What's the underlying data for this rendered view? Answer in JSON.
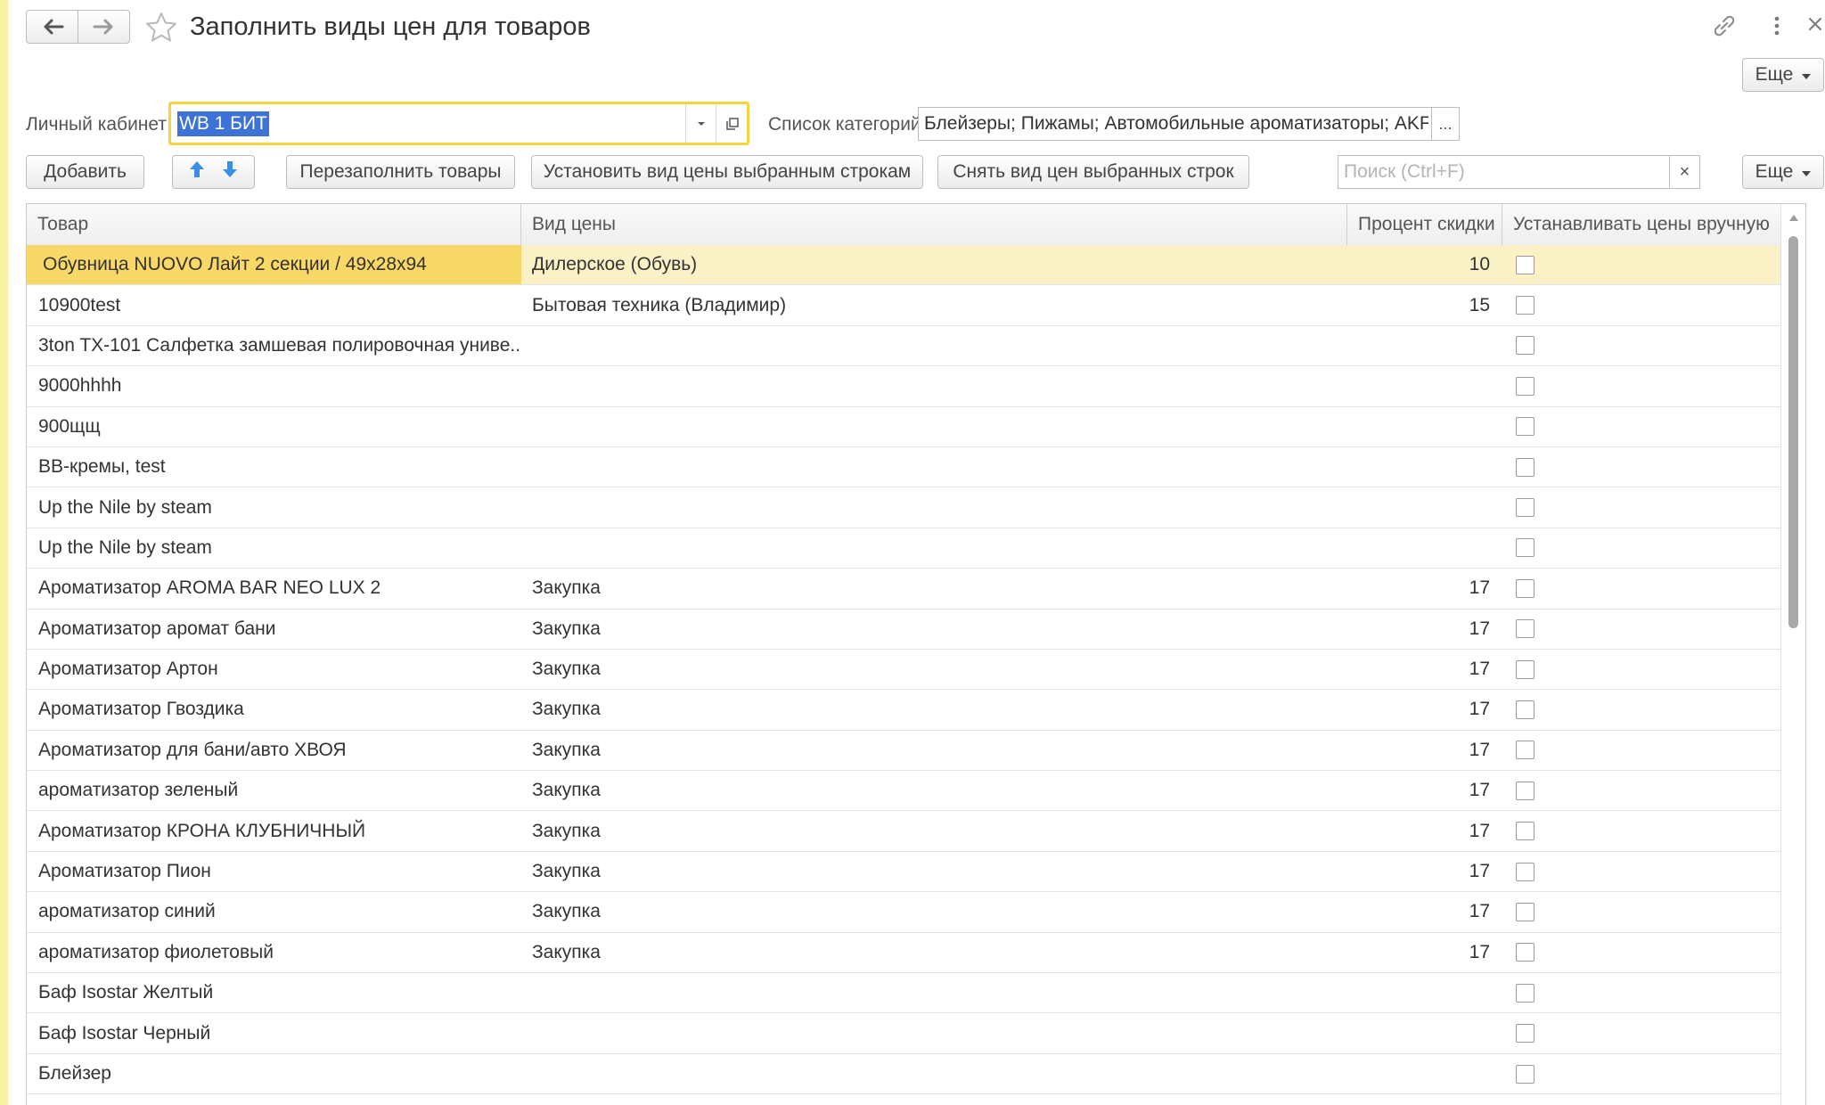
{
  "window": {
    "title": "Заполнить виды цен для товаров",
    "more_label": "Еще"
  },
  "form": {
    "cabinet_label": "Личный кабинет:",
    "cabinet_value": "WB 1 БИТ",
    "categories_label": "Список категорий:",
    "categories_value": "Блейзеры; Пижамы; Автомобильные ароматизаторы; AKF систе",
    "categories_more": "..."
  },
  "toolbar": {
    "add_label": "Добавить",
    "refill_label": "Перезаполнить товары",
    "set_price_label": "Установить вид цены выбранным строкам",
    "remove_price_label": "Снять вид цен выбранных строк",
    "search_placeholder": "Поиск (Ctrl+F)",
    "search_clear": "×",
    "more_label": "Еще"
  },
  "table": {
    "columns": [
      "Товар",
      "Вид цены",
      "Процент скидки",
      "Устанавливать цены вручную"
    ],
    "rows": [
      {
        "item": "Обувница NUOVO Лайт 2 секции / 49x28x94",
        "price_type": "Дилерское (Обувь)",
        "discount": "10",
        "manual": false,
        "selected": true
      },
      {
        "item": "10900test",
        "price_type": "Бытовая техника (Владимир)",
        "discount": "15",
        "manual": false
      },
      {
        "item": "3ton TX-101 Салфетка замшевая полировочная униве...",
        "price_type": "",
        "discount": "",
        "manual": false
      },
      {
        "item": "9000hhhh",
        "price_type": "",
        "discount": "",
        "manual": false
      },
      {
        "item": "900щщ",
        "price_type": "",
        "discount": "",
        "manual": false
      },
      {
        "item": "BB-кремы, test",
        "price_type": "",
        "discount": "",
        "manual": false
      },
      {
        "item": "Up the Nile by steam",
        "price_type": "",
        "discount": "",
        "manual": false
      },
      {
        "item": "Up the Nile by steam",
        "price_type": "",
        "discount": "",
        "manual": false
      },
      {
        "item": "Ароматизатор AROMA BAR NEO LUX 2",
        "price_type": "Закупка",
        "discount": "17",
        "manual": false
      },
      {
        "item": "Ароматизатор аромат бани",
        "price_type": "Закупка",
        "discount": "17",
        "manual": false
      },
      {
        "item": "Ароматизатор Артон",
        "price_type": "Закупка",
        "discount": "17",
        "manual": false
      },
      {
        "item": "Ароматизатор Гвоздика",
        "price_type": "Закупка",
        "discount": "17",
        "manual": false
      },
      {
        "item": "Ароматизатор для бани/авто ХВОЯ",
        "price_type": "Закупка",
        "discount": "17",
        "manual": false
      },
      {
        "item": "ароматизатор зеленый",
        "price_type": "Закупка",
        "discount": "17",
        "manual": false
      },
      {
        "item": "Ароматизатор КРОНА КЛУБНИЧНЫЙ",
        "price_type": "Закупка",
        "discount": "17",
        "manual": false
      },
      {
        "item": "Ароматизатор Пион",
        "price_type": "Закупка",
        "discount": "17",
        "manual": false
      },
      {
        "item": "ароматизатор синий",
        "price_type": "Закупка",
        "discount": "17",
        "manual": false
      },
      {
        "item": "ароматизатор фиолетовый",
        "price_type": "Закупка",
        "discount": "17",
        "manual": false
      },
      {
        "item": "Баф Isostar Желтый",
        "price_type": "",
        "discount": "",
        "manual": false
      },
      {
        "item": "Баф Isostar Черный",
        "price_type": "",
        "discount": "",
        "manual": false
      },
      {
        "item": "Блейзер",
        "price_type": "",
        "discount": "",
        "manual": false
      }
    ]
  },
  "icons": {
    "back": "arrow-left-icon",
    "forward": "arrow-right-icon",
    "favorite": "star-icon",
    "link": "link-icon",
    "menu": "more-vertical-icon",
    "close": "close-icon",
    "move_up": "arrow-up-icon",
    "move_down": "arrow-down-icon"
  },
  "colors": {
    "accent_yellow": "#f5d33f",
    "selected_row": "#fbf1c7",
    "selected_cell": "#f8d866",
    "move_arrows": "#3a8ee6",
    "selection_highlight": "#3d72d6",
    "left_strip": "#f7f1a0"
  }
}
